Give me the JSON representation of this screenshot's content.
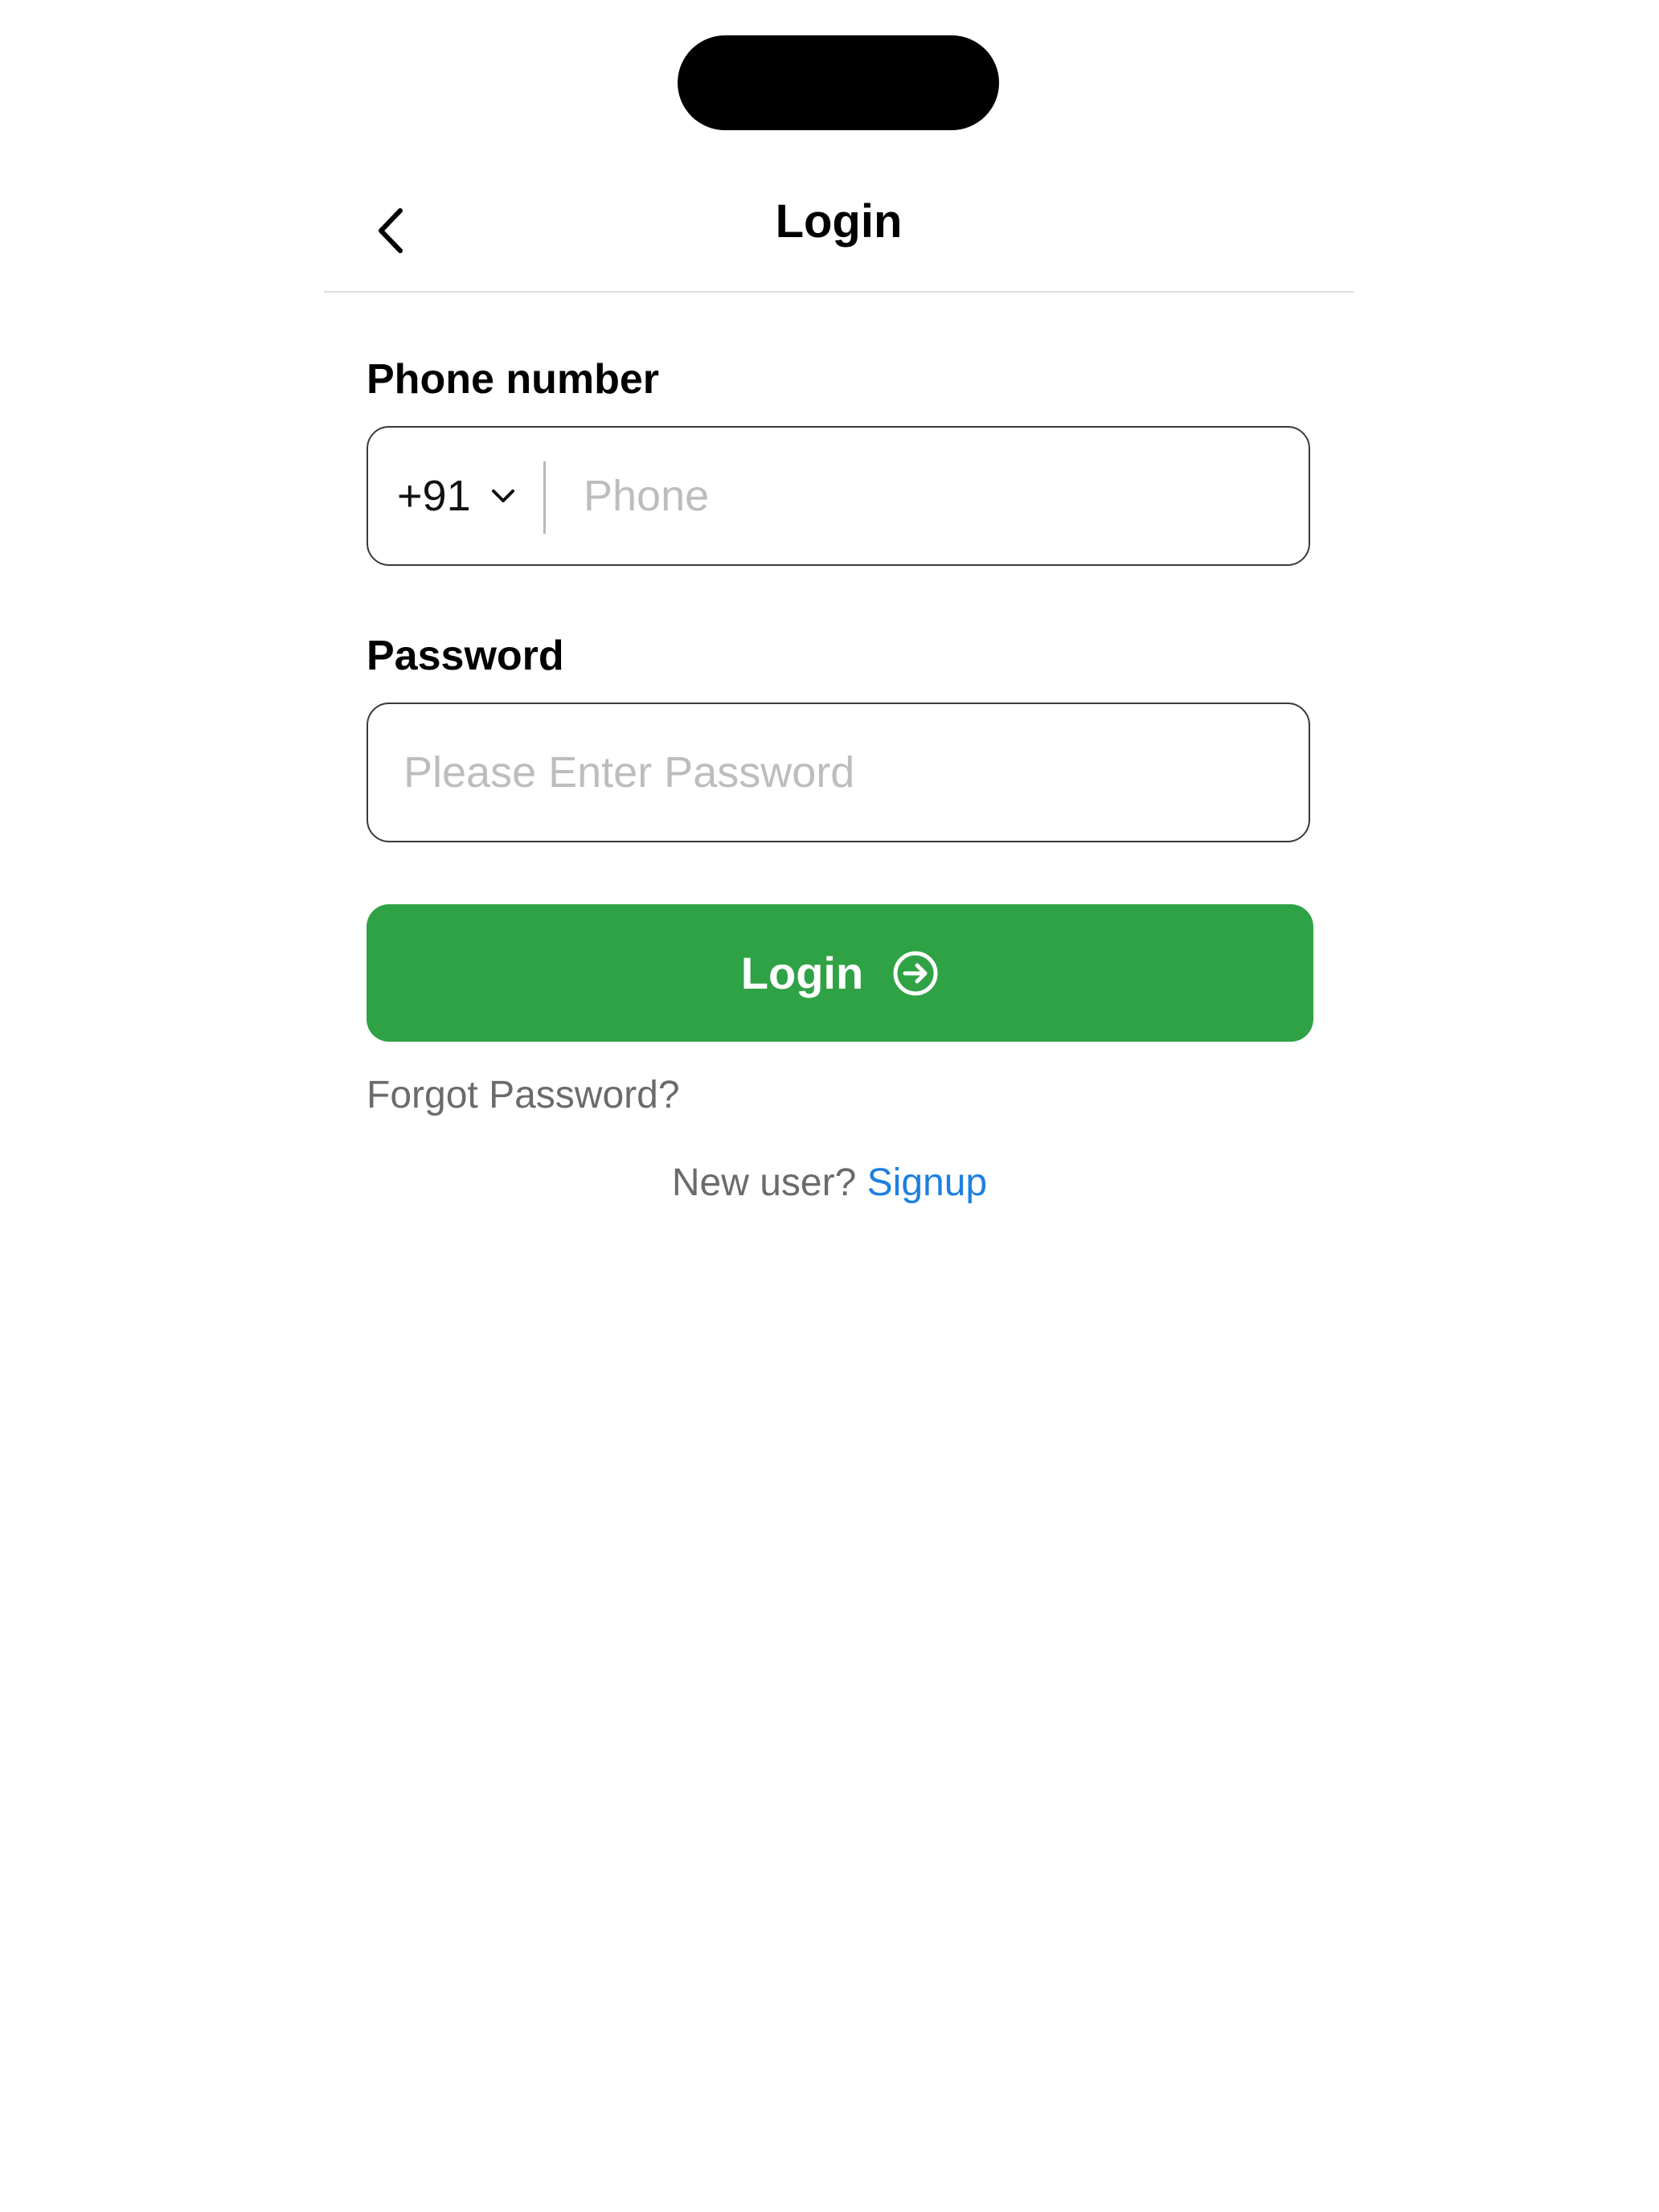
{
  "header": {
    "title": "Login",
    "back_icon": "chevron-left-icon"
  },
  "phone": {
    "label": "Phone number",
    "country_code": "+91",
    "dropdown_icon": "chevron-down-icon",
    "placeholder": "Phone",
    "value": ""
  },
  "password": {
    "label": "Password",
    "placeholder": "Please Enter Password",
    "value": ""
  },
  "login_button": {
    "label": "Login",
    "icon": "arrow-right-circle-icon",
    "color": "#30a246"
  },
  "forgot_password": {
    "label": "Forgot Password?"
  },
  "signup": {
    "prompt": "New user?",
    "link_label": "Signup",
    "link_color": "#1e7fe0"
  }
}
